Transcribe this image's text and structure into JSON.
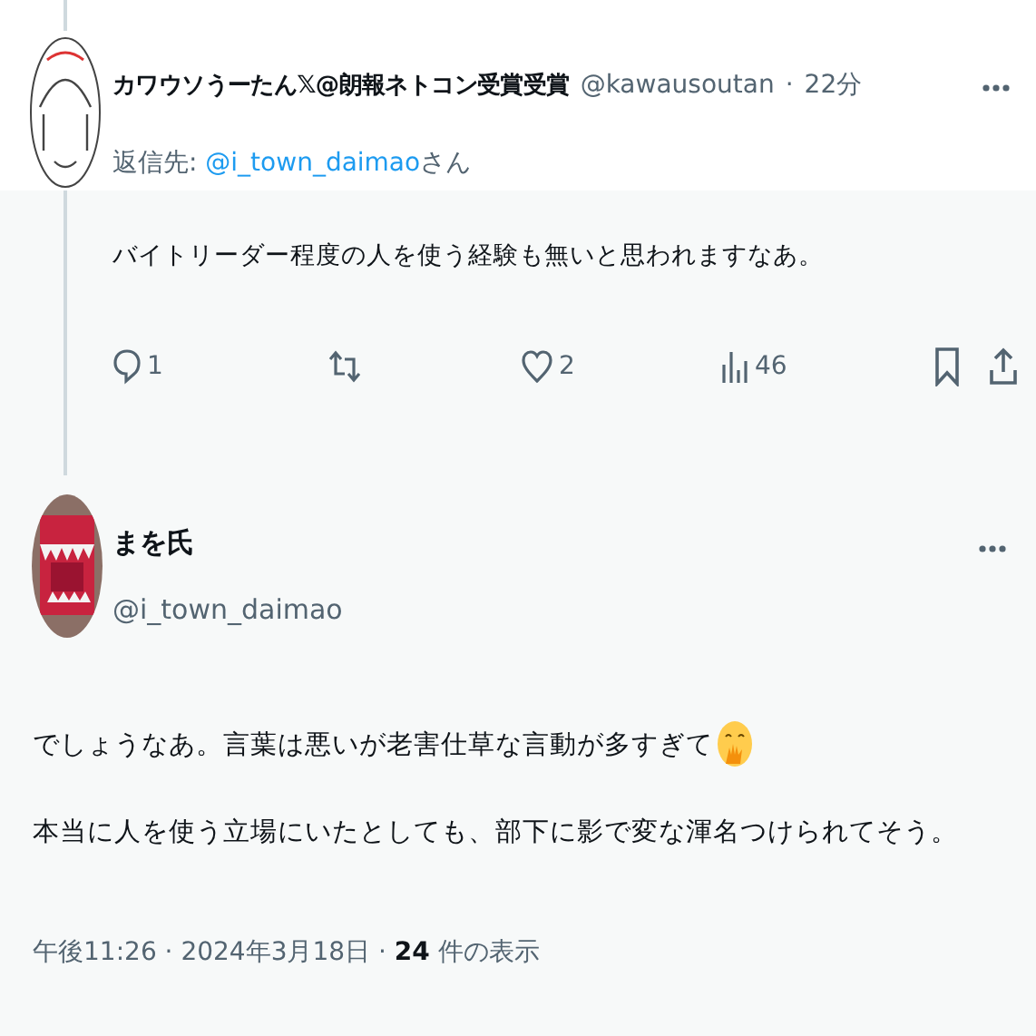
{
  "reply_tweet": {
    "display_name": "カワウソうーたん𝕏@朗報ネトコン受賞受賞",
    "handle": "@kawausoutan",
    "separator": "·",
    "time": "22分",
    "reply_to_label": "返信先: ",
    "reply_to_handle": "@i_town_daimao",
    "reply_to_suffix": "さん",
    "text": "バイトリーダー程度の人を使う経験も無いと思われますなあ。",
    "actions": [
      {
        "kind": "reply",
        "count": "1"
      },
      {
        "kind": "retweet"
      },
      {
        "kind": "like",
        "count": "2"
      },
      {
        "kind": "views",
        "count": "46"
      },
      {
        "kind": "bookmark"
      },
      {
        "kind": "share"
      }
    ]
  },
  "main_tweet": {
    "display_name": "まを氏",
    "handle": "@i_town_daimao",
    "lines": [
      "でしょうなあ。言葉は悪いが老害仕草な言動が多すぎて",
      "本当に人を使う立場にいたとしても、部下に影で変な渾名つけられてそう。"
    ],
    "meta": "午後11:26 · 2024年3月18日 · **24** 件の表示"
  }
}
